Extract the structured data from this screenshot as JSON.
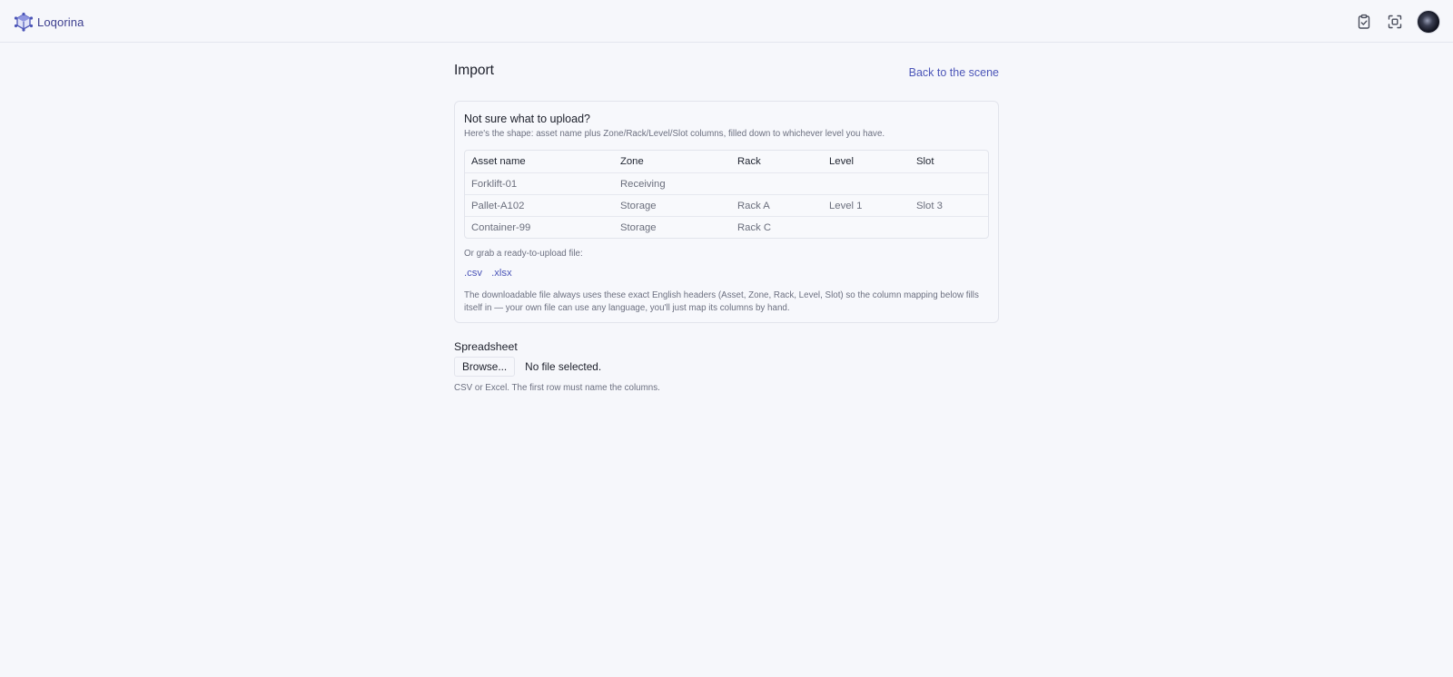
{
  "app": {
    "name": "Loqorina",
    "logo_icon": "cube-network-icon",
    "accent_color": "#4c56b8"
  },
  "topbar": {
    "actions": [
      {
        "name": "clipboard-check-icon",
        "label": ""
      },
      {
        "name": "scan-icon",
        "label": ""
      },
      {
        "name": "avatar",
        "label": ""
      }
    ]
  },
  "page": {
    "title": "Import",
    "back_link": "Back to the scene"
  },
  "info": {
    "title": "Not sure what to upload?",
    "subtitle": "Here's the shape: asset name plus Zone/Rack/Level/Slot columns, filled down to whichever level you have.",
    "table": {
      "headers": [
        "Asset name",
        "Zone",
        "Rack",
        "Level",
        "Slot"
      ],
      "rows": [
        [
          "Forklift-01",
          "Receiving",
          "",
          "",
          ""
        ],
        [
          "Pallet-A102",
          "Storage",
          "Rack A",
          "Level 1",
          "Slot 3"
        ],
        [
          "Container-99",
          "Storage",
          "Rack C",
          "",
          ""
        ]
      ]
    },
    "grab_text": "Or grab a ready-to-upload file:",
    "files": [
      ".csv",
      ".xlsx"
    ],
    "note": "The downloadable file always uses these exact English headers (Asset, Zone, Rack, Level, Slot) so the column mapping below fills itself in — your own file can use any language, you'll just map its columns by hand."
  },
  "upload": {
    "label": "Spreadsheet",
    "browse_label": "Browse...",
    "file_status": "No file selected.",
    "hint": "CSV or Excel. The first row must name the columns."
  }
}
